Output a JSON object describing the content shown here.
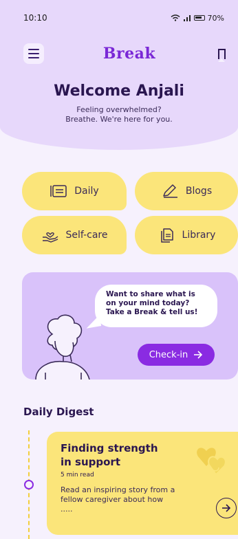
{
  "status": {
    "time": "10:10",
    "battery": "70%"
  },
  "header": {
    "app_name": "Break"
  },
  "welcome": {
    "title": "Welcome Anjali",
    "subtitle_line1": "Feeling overwhelmed?",
    "subtitle_line2": "Breathe. We're here for you."
  },
  "tiles": [
    {
      "label": "Daily",
      "icon": "daily-icon"
    },
    {
      "label": "Blogs",
      "icon": "pencil-icon"
    },
    {
      "label": "Self-care",
      "icon": "care-hand-icon"
    },
    {
      "label": "Library",
      "icon": "document-icon"
    }
  ],
  "checkin": {
    "prompt_line1": "Want to share what is",
    "prompt_line2": "on your mind today?",
    "prompt_line3": "Take a Break & tell us!",
    "button_label": "Check-in"
  },
  "digest": {
    "section_title": "Daily Digest",
    "card": {
      "title": "Finding strength in support",
      "read_time": "5 min read",
      "description": "Read an inspiring story from a fellow caregiver about how ....."
    }
  },
  "colors": {
    "accent": "#8a2be2",
    "tile": "#fbe57a",
    "hero": "#e7d8fb",
    "card": "#d9c2fa"
  }
}
